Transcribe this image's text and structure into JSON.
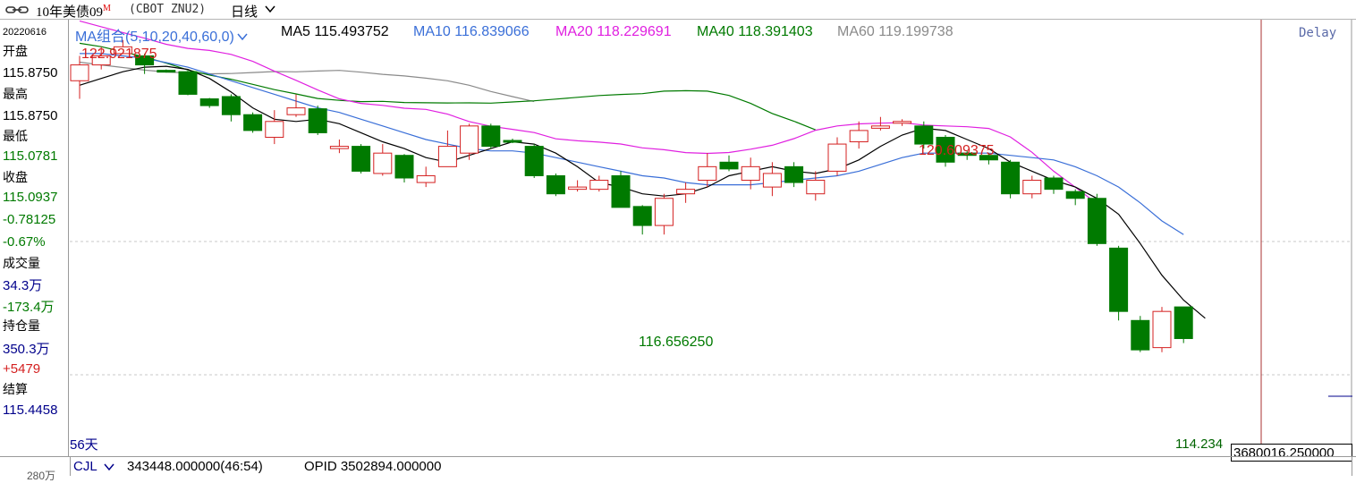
{
  "titlebar": {
    "title": "10年美债09",
    "title_mark": "M",
    "code": "(CBOT ZNU2)",
    "period": "日线"
  },
  "sidebar": {
    "date": "20220616",
    "open_label": "开盘",
    "open_value": "115.8750",
    "high_label": "最高",
    "high_value": "115.8750",
    "low_label": "最低",
    "low_value": "115.0781",
    "close_label": "收盘",
    "close_value": "115.0937",
    "change": "-0.78125",
    "change_pct": "-0.67%",
    "volume_label": "成交量",
    "volume_value": "34.3万",
    "volume_change": "-173.4万",
    "oi_label": "持仓量",
    "oi_value": "350.3万",
    "oi_change": "+5479",
    "settle_label": "结算",
    "settle_value": "115.4458"
  },
  "ma_header": {
    "combo": "MA组合(5,10,20,40,60,0)",
    "ma5": "MA5 115.493752",
    "ma10": "MA10 116.839066",
    "ma20": "MA20 118.229691",
    "ma40": "MA40 118.391403",
    "ma60": "MA60 119.199738",
    "delay": "Delay"
  },
  "colors": {
    "up": "#d42020",
    "down": "#007a00",
    "ma5": "#000000",
    "ma10": "#3a6fd8",
    "ma20": "#e020e0",
    "ma40": "#007a00",
    "ma60": "#8a8a8a"
  },
  "annotations": {
    "high_top": "122.921875",
    "high_mid": "120.609375",
    "low_mid": "116.656250",
    "low_end": "114.234",
    "days": "56天",
    "price_box": "3680016.250000"
  },
  "bottombar": {
    "indicator": "CJL",
    "volume": "343448.000000(46:54)",
    "opid": "OPID 3502894.000000",
    "axis_label": "280万"
  },
  "chart_data": {
    "type": "candlestick",
    "ylim": [
      113.9,
      123.55
    ],
    "candles": [
      {
        "o": 122.2,
        "c": 122.55,
        "h": 122.75,
        "l": 121.8
      },
      {
        "o": 122.55,
        "c": 122.75,
        "h": 122.95,
        "l": 122.45
      },
      {
        "o": 122.8,
        "c": 122.95,
        "h": 123.1,
        "l": 122.8
      },
      {
        "o": 122.75,
        "c": 122.55,
        "h": 122.8,
        "l": 122.35
      },
      {
        "o": 122.43,
        "c": 122.41,
        "h": 122.45,
        "l": 122.38
      },
      {
        "o": 122.4,
        "c": 121.9,
        "h": 122.42,
        "l": 121.88
      },
      {
        "o": 121.8,
        "c": 121.65,
        "h": 121.82,
        "l": 121.6
      },
      {
        "o": 121.85,
        "c": 121.45,
        "h": 121.9,
        "l": 121.3
      },
      {
        "o": 121.45,
        "c": 121.1,
        "h": 121.5,
        "l": 121.05
      },
      {
        "o": 120.95,
        "c": 121.3,
        "h": 121.55,
        "l": 120.8
      },
      {
        "o": 121.45,
        "c": 121.6,
        "h": 121.9,
        "l": 121.4
      },
      {
        "o": 121.58,
        "c": 121.05,
        "h": 121.65,
        "l": 121.0
      },
      {
        "o": 120.7,
        "c": 120.75,
        "h": 120.9,
        "l": 120.6
      },
      {
        "o": 120.75,
        "c": 120.2,
        "h": 120.8,
        "l": 120.15
      },
      {
        "o": 120.15,
        "c": 120.6,
        "h": 120.8,
        "l": 120.1
      },
      {
        "o": 120.55,
        "c": 120.05,
        "h": 120.58,
        "l": 119.95
      },
      {
        "o": 119.95,
        "c": 120.1,
        "h": 120.3,
        "l": 119.85
      },
      {
        "o": 120.3,
        "c": 120.75,
        "h": 121.1,
        "l": 120.3
      },
      {
        "o": 120.6,
        "c": 121.2,
        "h": 121.25,
        "l": 120.45
      },
      {
        "o": 121.2,
        "c": 120.75,
        "h": 121.25,
        "l": 120.7
      },
      {
        "o": 120.88,
        "c": 120.85,
        "h": 120.92,
        "l": 120.82
      },
      {
        "o": 120.75,
        "c": 120.1,
        "h": 120.8,
        "l": 120.05
      },
      {
        "o": 120.1,
        "c": 119.7,
        "h": 120.15,
        "l": 119.65
      },
      {
        "o": 119.8,
        "c": 119.85,
        "h": 120.0,
        "l": 119.75
      },
      {
        "o": 119.8,
        "c": 120.0,
        "h": 120.1,
        "l": 119.75
      },
      {
        "o": 120.1,
        "c": 119.4,
        "h": 120.2,
        "l": 119.4
      },
      {
        "o": 119.42,
        "c": 119.0,
        "h": 119.45,
        "l": 118.8
      },
      {
        "o": 119.0,
        "c": 119.6,
        "h": 119.7,
        "l": 118.8
      },
      {
        "o": 119.7,
        "c": 119.8,
        "h": 119.95,
        "l": 119.5
      },
      {
        "o": 120.0,
        "c": 120.3,
        "h": 120.6,
        "l": 119.85
      },
      {
        "o": 120.4,
        "c": 120.25,
        "h": 120.55,
        "l": 120.2
      },
      {
        "o": 120.0,
        "c": 120.3,
        "h": 120.5,
        "l": 119.8
      },
      {
        "o": 119.85,
        "c": 120.15,
        "h": 120.4,
        "l": 119.65
      },
      {
        "o": 120.3,
        "c": 119.95,
        "h": 120.4,
        "l": 119.85
      },
      {
        "o": 119.7,
        "c": 120.0,
        "h": 120.2,
        "l": 119.55
      },
      {
        "o": 120.2,
        "c": 120.8,
        "h": 120.95,
        "l": 120.1
      },
      {
        "o": 120.85,
        "c": 121.1,
        "h": 121.3,
        "l": 120.7
      },
      {
        "o": 121.15,
        "c": 121.2,
        "h": 121.4,
        "l": 121.1
      },
      {
        "o": 121.3,
        "c": 121.3,
        "h": 121.35,
        "l": 121.2
      },
      {
        "o": 121.2,
        "c": 120.8,
        "h": 121.3,
        "l": 120.7
      },
      {
        "o": 120.95,
        "c": 120.4,
        "h": 121.0,
        "l": 120.3
      },
      {
        "o": 120.6,
        "c": 120.55,
        "h": 120.65,
        "l": 120.45
      },
      {
        "o": 120.55,
        "c": 120.45,
        "h": 120.6,
        "l": 120.35
      },
      {
        "o": 120.4,
        "c": 119.7,
        "h": 120.45,
        "l": 119.6
      },
      {
        "o": 119.7,
        "c": 120.0,
        "h": 120.1,
        "l": 119.6
      },
      {
        "o": 120.05,
        "c": 119.8,
        "h": 120.1,
        "l": 119.7
      },
      {
        "o": 119.75,
        "c": 119.6,
        "h": 119.8,
        "l": 119.45
      },
      {
        "o": 119.6,
        "c": 118.6,
        "h": 119.7,
        "l": 118.55
      },
      {
        "o": 118.5,
        "c": 117.1,
        "h": 118.55,
        "l": 116.9
      },
      {
        "o": 116.9,
        "c": 116.25,
        "h": 117.0,
        "l": 116.2
      },
      {
        "o": 116.3,
        "c": 117.1,
        "h": 117.2,
        "l": 116.2
      },
      {
        "o": 117.2,
        "c": 116.5,
        "h": 117.2,
        "l": 116.4
      }
    ],
    "ma5": [
      122.1,
      122.25,
      122.4,
      122.5,
      122.52,
      122.45,
      122.25,
      121.95,
      121.6,
      121.35,
      121.3,
      121.35,
      121.25,
      121.05,
      120.85,
      120.7,
      120.5,
      120.4,
      120.55,
      120.7,
      120.85,
      120.8,
      120.6,
      120.3,
      119.95,
      119.85,
      119.7,
      119.65,
      119.7,
      119.85,
      120.1,
      120.2,
      120.3,
      120.2,
      120.15,
      120.25,
      120.45,
      120.75,
      121.0,
      121.15,
      121.1,
      120.9,
      120.7,
      120.4,
      120.2,
      120.0,
      119.85,
      119.6,
      119.25,
      118.6,
      117.9,
      117.35,
      116.95
    ],
    "ma10": [
      122.8,
      122.8,
      122.75,
      122.7,
      122.6,
      122.5,
      122.35,
      122.2,
      122.05,
      121.9,
      121.75,
      121.6,
      121.5,
      121.35,
      121.2,
      121.05,
      120.9,
      120.8,
      120.7,
      120.65,
      120.65,
      120.6,
      120.5,
      120.4,
      120.3,
      120.2,
      120.1,
      120.05,
      119.95,
      119.9,
      119.9,
      119.9,
      119.95,
      120.0,
      120.05,
      120.1,
      120.2,
      120.35,
      120.5,
      120.6,
      120.6,
      120.6,
      120.6,
      120.55,
      120.5,
      120.45,
      120.3,
      120.1,
      119.85,
      119.5,
      119.1,
      118.8
    ],
    "ma20": [],
    "ma40": [],
    "ma60": []
  }
}
